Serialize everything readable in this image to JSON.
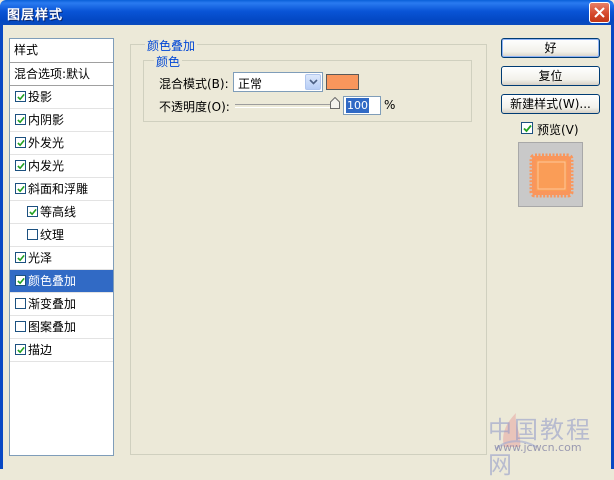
{
  "window": {
    "title": "图层样式"
  },
  "style_list": {
    "header": "样式",
    "blend_default": "混合选项:默认",
    "items": [
      {
        "label": "投影",
        "checked": true,
        "indent": false,
        "selected": false
      },
      {
        "label": "内阴影",
        "checked": true,
        "indent": false,
        "selected": false
      },
      {
        "label": "外发光",
        "checked": true,
        "indent": false,
        "selected": false
      },
      {
        "label": "内发光",
        "checked": true,
        "indent": false,
        "selected": false
      },
      {
        "label": "斜面和浮雕",
        "checked": true,
        "indent": false,
        "selected": false
      },
      {
        "label": "等高线",
        "checked": true,
        "indent": true,
        "selected": false
      },
      {
        "label": "纹理",
        "checked": false,
        "indent": true,
        "selected": false
      },
      {
        "label": "光泽",
        "checked": true,
        "indent": false,
        "selected": false
      },
      {
        "label": "颜色叠加",
        "checked": true,
        "indent": false,
        "selected": true
      },
      {
        "label": "渐变叠加",
        "checked": false,
        "indent": false,
        "selected": false
      },
      {
        "label": "图案叠加",
        "checked": false,
        "indent": false,
        "selected": false
      },
      {
        "label": "描边",
        "checked": true,
        "indent": false,
        "selected": false
      }
    ]
  },
  "color_overlay": {
    "section_title": "颜色叠加",
    "subsection_title": "颜色",
    "blend_mode_label": "混合模式(B):",
    "blend_mode_value": "正常",
    "overlay_color": "#f9965c",
    "opacity_label": "不透明度(O):",
    "opacity_value": "100",
    "opacity_unit": "%"
  },
  "buttons": {
    "ok": "好",
    "reset": "复位",
    "new_style": "新建样式(W)..."
  },
  "preview": {
    "label": "预览(V)",
    "checked": true
  },
  "watermark": {
    "text": "中国教程网",
    "url": "www.jcwcn.com"
  }
}
